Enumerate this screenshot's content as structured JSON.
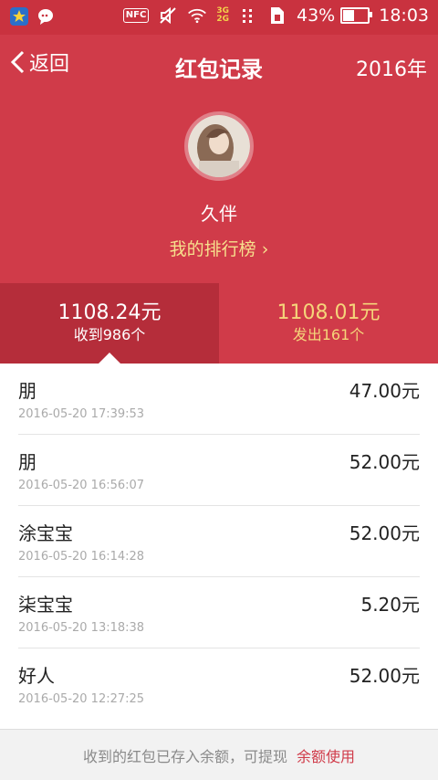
{
  "status_bar": {
    "icons_left": [
      "star-badge-icon",
      "chat-bubble-icon"
    ],
    "nfc_label": "NFC",
    "network_top": "3G",
    "network_bottom": "2G",
    "battery_percent": "43%",
    "battery_level": 0.43,
    "time": "18:03"
  },
  "header": {
    "back_label": "返回",
    "title": "红包记录",
    "year": "2016年",
    "username": "久伴",
    "rank_link": "我的排行榜",
    "background_color": "#d03b49"
  },
  "tabs": {
    "received": {
      "amount": "1108.24元",
      "count": "收到986个"
    },
    "sent": {
      "amount": "1108.01元",
      "count": "发出161个"
    }
  },
  "records": [
    {
      "name": "朋",
      "time": "2016-05-20 17:39:53",
      "amount": "47.00元"
    },
    {
      "name": "朋",
      "time": "2016-05-20 16:56:07",
      "amount": "52.00元"
    },
    {
      "name": "涂宝宝",
      "time": "2016-05-20 16:14:28",
      "amount": "52.00元"
    },
    {
      "name": "柒宝宝",
      "time": "2016-05-20 13:18:38",
      "amount": "5.20元"
    },
    {
      "name": "好人",
      "time": "2016-05-20 12:27:25",
      "amount": "52.00元"
    }
  ],
  "footer": {
    "note": "收到的红包已存入余额，可提现",
    "link": "余额使用"
  }
}
